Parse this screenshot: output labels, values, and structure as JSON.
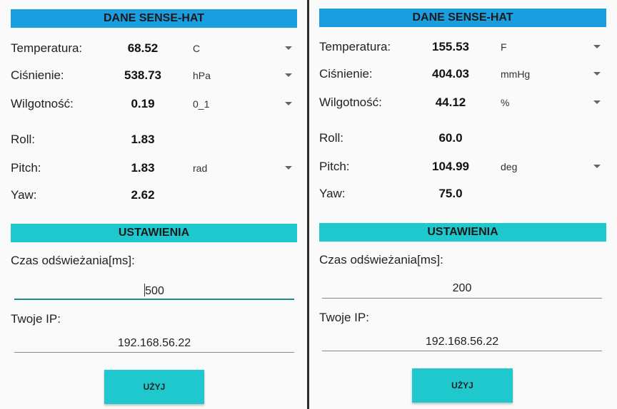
{
  "left": {
    "header": "DANE SENSE-HAT",
    "rows": [
      {
        "label": "Temperatura:",
        "value": "68.52",
        "unit": "C"
      },
      {
        "label": "Ciśnienie:",
        "value": "538.73",
        "unit": "hPa"
      },
      {
        "label": "Wilgotność:",
        "value": "0.19",
        "unit": "0_1"
      },
      {
        "label": "Roll:",
        "value": "1.83",
        "unit": ""
      },
      {
        "label": "Pitch:",
        "value": "1.83",
        "unit": "rad"
      },
      {
        "label": "Yaw:",
        "value": "2.62",
        "unit": ""
      }
    ],
    "settings_header": "USTAWIENIA",
    "refresh_label": "Czas odświeżania[ms]:",
    "refresh_value": "500",
    "ip_label": "Twoje IP:",
    "ip_value": "192.168.56.22",
    "button_label": "UŻYJ"
  },
  "right": {
    "header": "DANE SENSE-HAT",
    "rows": [
      {
        "label": "Temperatura:",
        "value": "155.53",
        "unit": "F"
      },
      {
        "label": "Ciśnienie:",
        "value": "404.03",
        "unit": "mmHg"
      },
      {
        "label": "Wilgotność:",
        "value": "44.12",
        "unit": "%"
      },
      {
        "label": "Roll:",
        "value": "60.0",
        "unit": ""
      },
      {
        "label": "Pitch:",
        "value": "104.99",
        "unit": "deg"
      },
      {
        "label": "Yaw:",
        "value": "75.0",
        "unit": ""
      }
    ],
    "settings_header": "USTAWIENIA",
    "refresh_label": "Czas odświeżania[ms]:",
    "refresh_value": "200",
    "ip_label": "Twoje IP:",
    "ip_value": "192.168.56.22",
    "button_label": "UŻYJ"
  },
  "colors": {
    "header_blue": "#1a9ee0",
    "header_teal": "#1ec8cd",
    "button": "#1ec8cd",
    "active_underline": "#1a8a8a",
    "inactive_underline": "#888888"
  }
}
